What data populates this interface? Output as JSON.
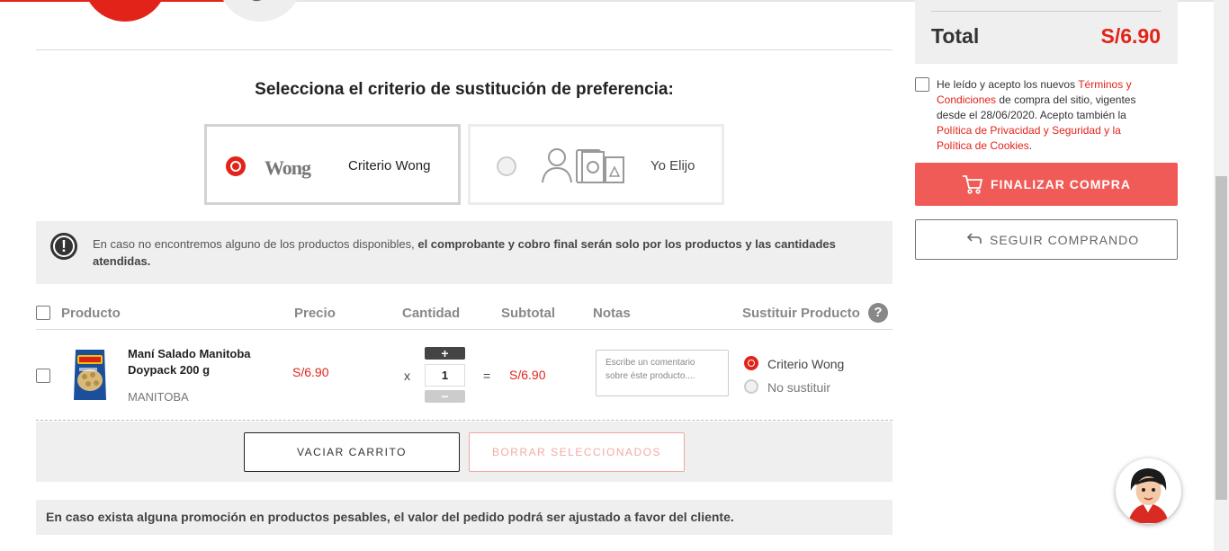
{
  "substitution": {
    "title": "Selecciona el criterio de sustitución de preferencia:",
    "options": [
      {
        "logo": "Wong",
        "label": "Criterio Wong",
        "selected": true
      },
      {
        "label": "Yo Elijo",
        "selected": false
      }
    ]
  },
  "notice": {
    "text_normal": "En caso no encontremos alguno de los productos disponibles, ",
    "text_bold": "el comprobante y cobro final serán solo por los productos y las cantidades atendidas."
  },
  "table": {
    "headers": {
      "product": "Producto",
      "price": "Precio",
      "quantity": "Cantidad",
      "subtotal": "Subtotal",
      "notes": "Notas",
      "substitute": "Sustituir Producto",
      "help": "?"
    },
    "rows": [
      {
        "name": "Maní Salado Manitoba Doypack 200 g",
        "brand": "MANITOBA",
        "price": "S/6.90",
        "times": "x",
        "quantity": "1",
        "equals": "=",
        "subtotal": "S/6.90",
        "notes_placeholder": "Escribe un comentario sobre éste producto....",
        "substitute_options": [
          {
            "label": "Criterio Wong",
            "selected": true
          },
          {
            "label": "No sustituir",
            "selected": false
          }
        ]
      }
    ],
    "plus": "+",
    "minus": "−"
  },
  "actions": {
    "empty_cart": "VACIAR CARRITO",
    "delete_selected": "BORRAR SELECCIONADOS"
  },
  "promo_note": "En caso exista alguna promoción en productos pesables, el valor del pedido podrá ser ajustado a favor del cliente.",
  "summary": {
    "total_label": "Total",
    "total_value": "S/6.90"
  },
  "terms": {
    "part1": "He leído y acepto los nuevos ",
    "link1": "Términos y Condiciones",
    "part2": " de compra del sitio, vigentes desde el 28/06/2020. Acepto también la ",
    "link2": "Política de Privacidad y Seguridad y la Política de Cookies",
    "part3": "."
  },
  "buttons": {
    "finalize": "FINALIZAR COMPRA",
    "continue": "SEGUIR COMPRANDO"
  },
  "colors": {
    "brand_red": "#e2231a",
    "button_red": "#f15b57"
  }
}
